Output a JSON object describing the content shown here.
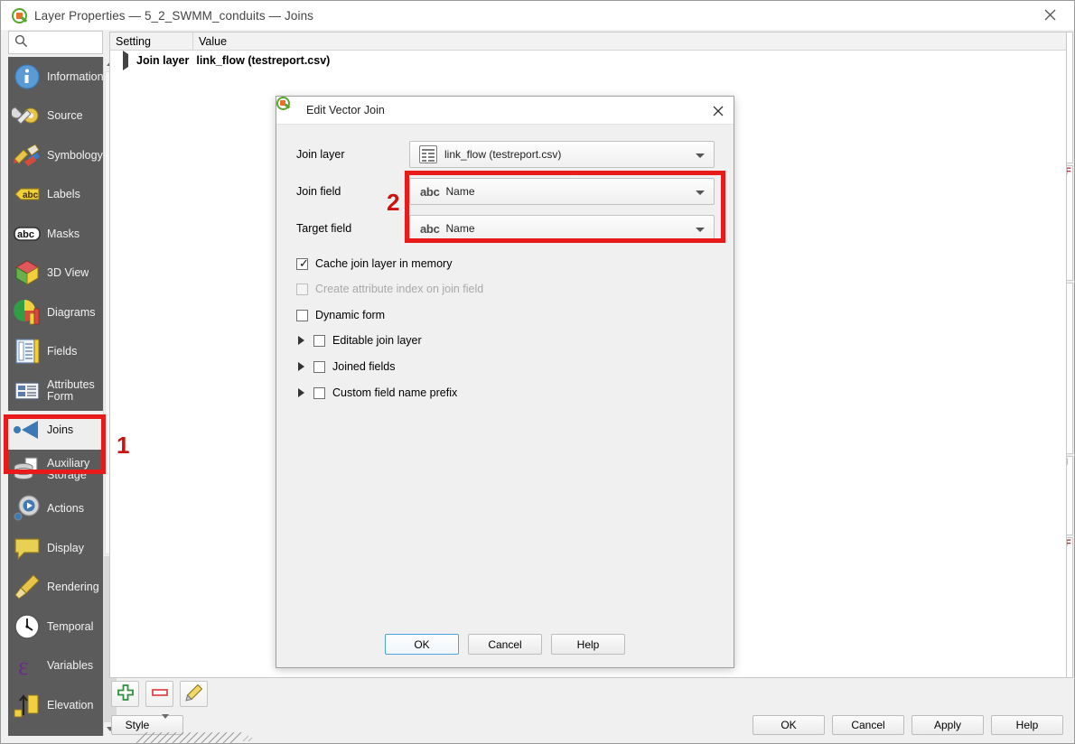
{
  "window": {
    "title": "Layer Properties — 5_2_SWMM_conduits — Joins",
    "logo_icon": "qgis-logo-icon",
    "close_icon": "close-icon"
  },
  "sidebar": {
    "search": {
      "value": "",
      "placeholder": "",
      "icon": "search-icon"
    },
    "items": [
      {
        "label": "Information",
        "icon": "information-icon",
        "selected": false
      },
      {
        "label": "Source",
        "icon": "source-icon",
        "selected": false
      },
      {
        "label": "Symbology",
        "icon": "symbology-icon",
        "selected": false
      },
      {
        "label": "Labels",
        "icon": "labels-abc-icon",
        "selected": false
      },
      {
        "label": "Masks",
        "icon": "masks-abc-icon",
        "selected": false
      },
      {
        "label": "3D View",
        "icon": "3d-view-cube-icon",
        "selected": false
      },
      {
        "label": "Diagrams",
        "icon": "diagrams-piechart-icon",
        "selected": false
      },
      {
        "label": "Fields",
        "icon": "fields-table-icon",
        "selected": false
      },
      {
        "label": "Attributes Form",
        "icon": "attributes-form-icon",
        "selected": false
      },
      {
        "label": "Joins",
        "icon": "joins-arrow-icon",
        "selected": true
      },
      {
        "label": "Auxiliary Storage",
        "icon": "auxiliary-storage-db-icon",
        "selected": false
      },
      {
        "label": "Actions",
        "icon": "actions-gear-play-icon",
        "selected": false
      },
      {
        "label": "Display",
        "icon": "display-balloon-icon",
        "selected": false
      },
      {
        "label": "Rendering",
        "icon": "rendering-brush-icon",
        "selected": false
      },
      {
        "label": "Temporal",
        "icon": "temporal-clock-icon",
        "selected": false
      },
      {
        "label": "Variables",
        "icon": "variables-epsilon-icon",
        "selected": false
      },
      {
        "label": "Elevation",
        "icon": "elevation-arrow-icon",
        "selected": false
      }
    ],
    "scroll_up_icon": "scroll-up-arrow-icon",
    "scroll_down_icon": "scroll-down-arrow-icon"
  },
  "joins_table": {
    "columns": [
      "Setting",
      "Value"
    ],
    "rows": [
      {
        "expander_icon": "expand-right-icon",
        "setting": "Join layer",
        "value": "link_flow (testreport.csv)"
      }
    ]
  },
  "joins_toolbar": {
    "add": {
      "label": "",
      "icon": "add-join-plus-icon"
    },
    "remove": {
      "label": "",
      "icon": "remove-join-minus-icon"
    },
    "edit": {
      "label": "",
      "icon": "edit-join-pencil-icon"
    }
  },
  "style_button": {
    "label": "Style",
    "caret_icon": "chevron-down-icon"
  },
  "main_buttons": [
    {
      "label": "OK"
    },
    {
      "label": "Cancel"
    },
    {
      "label": "Apply"
    },
    {
      "label": "Help"
    }
  ],
  "dialog": {
    "title": "Edit Vector Join",
    "logo_icon": "qgis-logo-icon",
    "close_icon": "close-icon",
    "fields": {
      "join_layer": {
        "label": "Join layer",
        "value": "link_flow (testreport.csv)",
        "icon": "csv-table-icon",
        "caret_icon": "chevron-down-icon"
      },
      "join_field": {
        "label": "Join field",
        "value": "Name",
        "type_icon": "abc-string-icon",
        "caret_icon": "chevron-down-icon"
      },
      "target_field": {
        "label": "Target field",
        "value": "Name",
        "type_icon": "abc-string-icon",
        "caret_icon": "chevron-down-icon"
      }
    },
    "checkboxes": [
      {
        "label": "Cache join layer in memory",
        "checked": true,
        "disabled": false,
        "expandable": false
      },
      {
        "label": "Create attribute index on join field",
        "checked": false,
        "disabled": true,
        "expandable": false
      },
      {
        "label": "Dynamic form",
        "checked": false,
        "disabled": false,
        "expandable": false
      },
      {
        "label": "Editable join layer",
        "checked": false,
        "disabled": false,
        "expandable": true
      },
      {
        "label": "Joined fields",
        "checked": false,
        "disabled": false,
        "expandable": true
      },
      {
        "label": "Custom field name prefix",
        "checked": false,
        "disabled": false,
        "expandable": true
      }
    ],
    "buttons": [
      {
        "label": "OK",
        "default": true
      },
      {
        "label": "Cancel",
        "default": false
      },
      {
        "label": "Help",
        "default": false
      }
    ]
  },
  "annotations": [
    {
      "number": "1",
      "target": "sidebar-item-joins",
      "color": "#e81a1a"
    },
    {
      "number": "2",
      "target": "join-and-target-field-combos",
      "color": "#e81a1a"
    }
  ],
  "hidden_panel_slivers": [
    "F",
    "F",
    "I",
    "F"
  ]
}
